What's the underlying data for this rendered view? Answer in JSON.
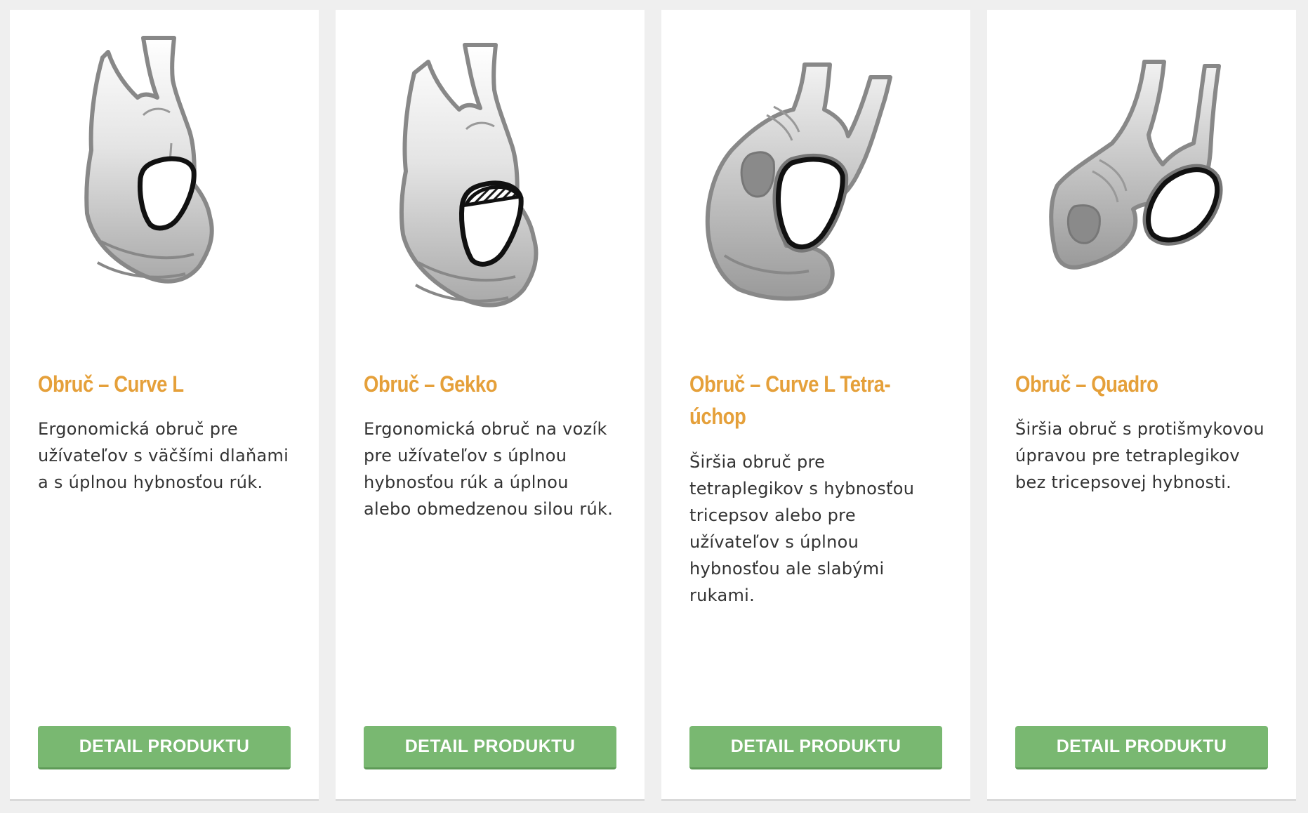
{
  "products": [
    {
      "title": "Obruč – Curve L",
      "description": "Ergonomická obruč pre užívateľov s väčšími dlaňami a s úplnou hybnosťou rúk.",
      "button_label": "DETAIL PRODUKTU",
      "illustration_icon": "hand-gripping-curve-l-rim-icon"
    },
    {
      "title": "Obruč – Gekko",
      "description": "Ergonomická obruč na vozík pre užívateľov s úplnou hybnosťou rúk a úplnou alebo obmedzenou silou rúk.",
      "button_label": "DETAIL PRODUKTU",
      "illustration_icon": "hand-gripping-gekko-rim-icon"
    },
    {
      "title": "Obruč – Curve L Tetra-úchop",
      "description": "Širšia obruč pre tetraplegikov s hybnosťou tricepsov alebo pre užívateľov s úplnou hybnosťou ale slabými rukami.",
      "button_label": "DETAIL PRODUKTU",
      "illustration_icon": "hand-gripping-tetra-rim-icon"
    },
    {
      "title": "Obruč – Quadro",
      "description": "Širšia obruč s protišmykovou úpravou pre tetraplegikov bez tricepsovej hybnosti.",
      "button_label": "DETAIL PRODUKTU",
      "illustration_icon": "hand-gripping-quadro-rim-icon"
    }
  ],
  "colors": {
    "page_background": "#efefef",
    "card_background": "#ffffff",
    "title": "#e5a03a",
    "body_text": "#333333",
    "button": "#79b871",
    "button_text": "#ffffff"
  }
}
